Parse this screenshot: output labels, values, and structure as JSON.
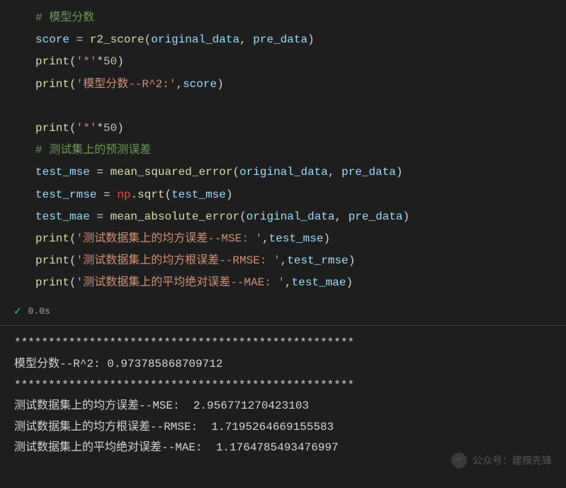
{
  "code": {
    "comment1": "# 模型分数",
    "line2_var": "score",
    "line2_eq": " = ",
    "line2_func": "r2_score",
    "line2_open": "(",
    "line2_arg1": "original_data",
    "line2_comma": ", ",
    "line2_arg2": "pre_data",
    "line2_close": ")",
    "line3_func": "print",
    "line3_open": "(",
    "line3_str": "'*'",
    "line3_op": "*",
    "line3_num": "50",
    "line3_close": ")",
    "line4_func": "print",
    "line4_open": "(",
    "line4_str": "'模型分数--R^2:'",
    "line4_comma": ",",
    "line4_arg": "score",
    "line4_close": ")",
    "line6_func": "print",
    "line6_open": "(",
    "line6_str": "'*'",
    "line6_op": "*",
    "line6_num": "50",
    "line6_close": ")",
    "comment2": "# 测试集上的预测误差",
    "line8_var": "test_mse",
    "line8_eq": " = ",
    "line8_func": "mean_squared_error",
    "line8_open": "(",
    "line8_arg1": "original_data",
    "line8_comma": ", ",
    "line8_arg2": "pre_data",
    "line8_close": ")",
    "line9_var": "test_rmse",
    "line9_eq": " = ",
    "line9_mod": "np",
    "line9_dot": ".",
    "line9_func": "sqrt",
    "line9_open": "(",
    "line9_arg": "test_mse",
    "line9_close": ")",
    "line10_var": "test_mae",
    "line10_eq": " = ",
    "line10_func": "mean_absolute_error",
    "line10_open": "(",
    "line10_arg1": "original_data",
    "line10_comma": ", ",
    "line10_arg2": "pre_data",
    "line10_close": ")",
    "line11_func": "print",
    "line11_open": "(",
    "line11_str": "'测试数据集上的均方误差--MSE: '",
    "line11_comma": ",",
    "line11_arg": "test_mse",
    "line11_close": ")",
    "line12_func": "print",
    "line12_open": "(",
    "line12_str": "'测试数据集上的均方根误差--RMSE: '",
    "line12_comma": ",",
    "line12_arg": "test_rmse",
    "line12_close": ")",
    "line13_func": "print",
    "line13_open": "(",
    "line13_str": "'测试数据集上的平均绝对误差--MAE: '",
    "line13_comma": ",",
    "line13_arg": "test_mae",
    "line13_close": ")"
  },
  "status": {
    "checkmark": "✓",
    "time": "0.0s"
  },
  "output": {
    "line1": "**************************************************",
    "line2": "模型分数--R^2: 0.973785868709712",
    "line3": "**************************************************",
    "line4": "测试数据集上的均方误差--MSE:  2.956771270423103",
    "line5": "测试数据集上的均方根误差--RMSE:  1.7195264669155583",
    "line6": "测试数据集上的平均绝对误差--MAE:  1.1764785493476997"
  },
  "watermark": {
    "icon": "∞",
    "text": "公众号：建模先锋"
  }
}
